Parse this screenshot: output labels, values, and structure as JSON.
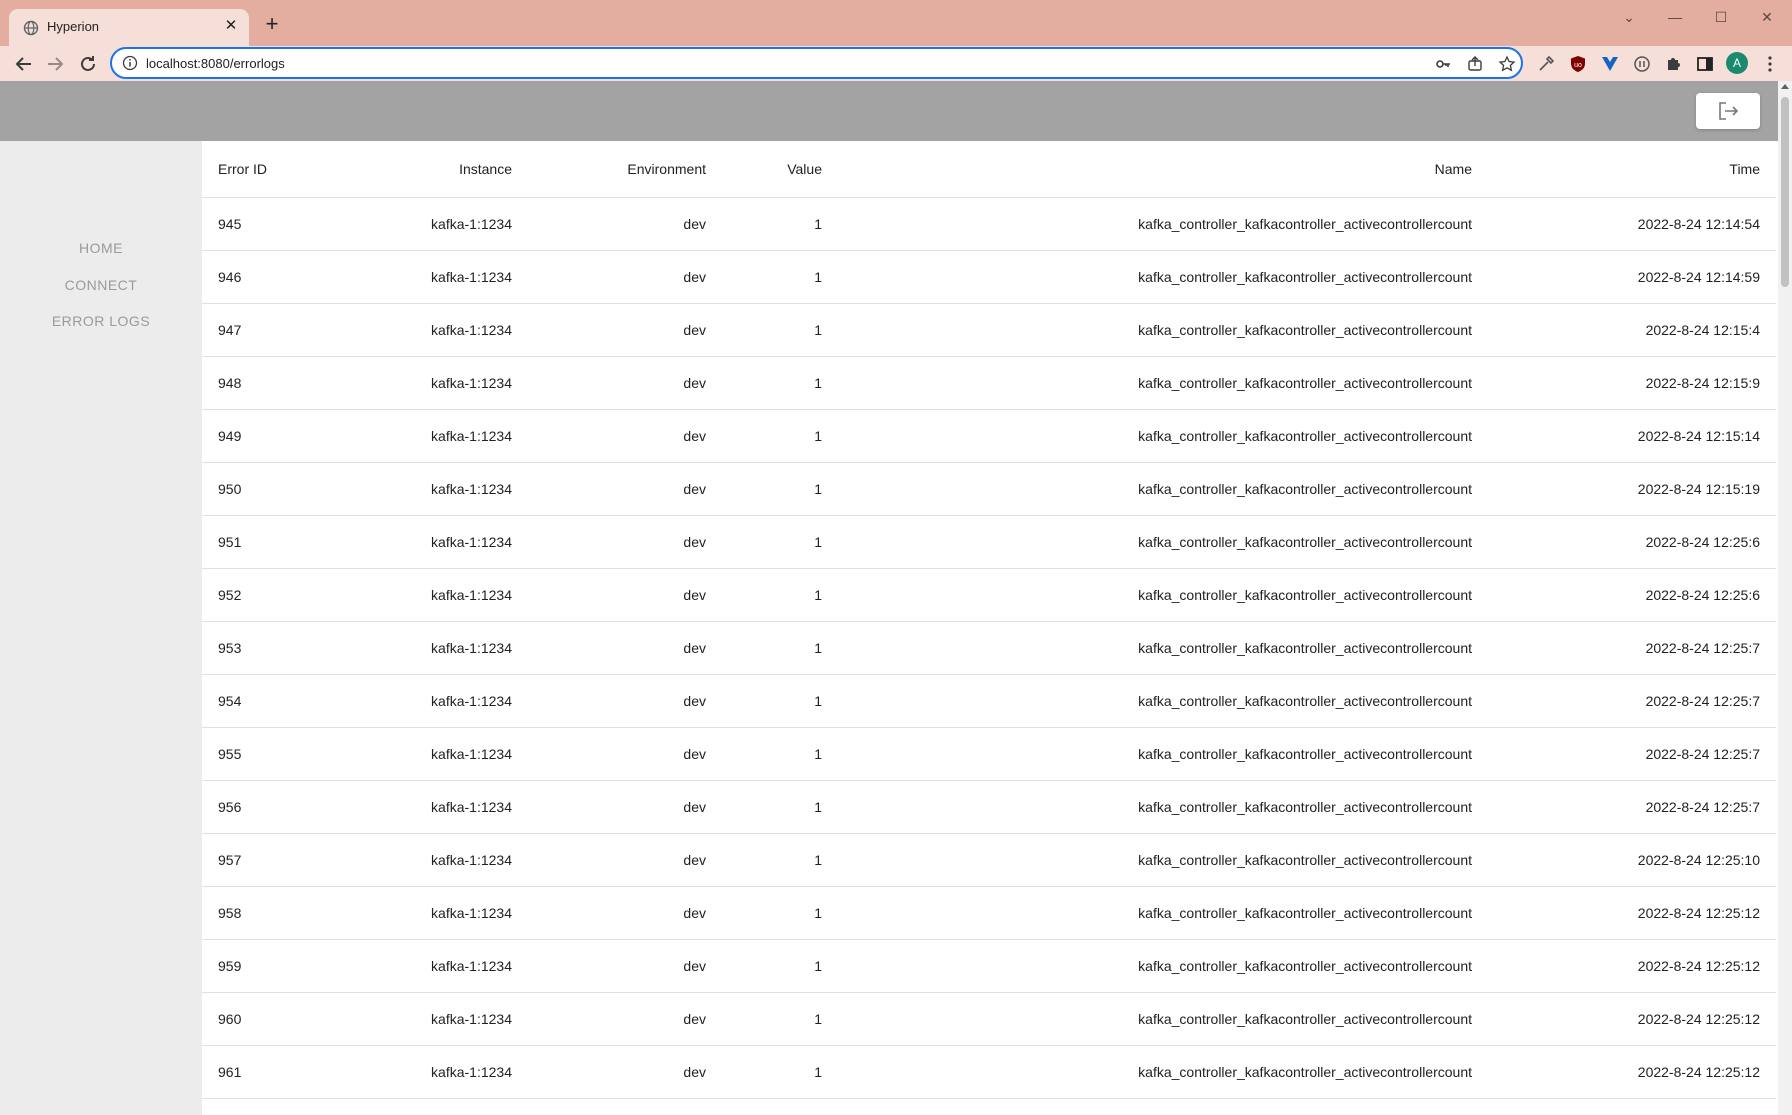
{
  "browser": {
    "tab_title": "Hyperion",
    "tab_close_glyph": "✕",
    "new_tab_glyph": "+",
    "url": "localhost:8080/errorlogs",
    "profile_initial": "A",
    "window_controls": [
      "⌄",
      "—",
      "☐",
      "✕"
    ]
  },
  "sidebar": {
    "items": [
      {
        "label": "HOME"
      },
      {
        "label": "CONNECT"
      },
      {
        "label": "ERROR LOGS"
      }
    ]
  },
  "table": {
    "headers": {
      "error_id": "Error ID",
      "instance": "Instance",
      "environment": "Environment",
      "value": "Value",
      "name": "Name",
      "time": "Time"
    },
    "rows": [
      {
        "id": "945",
        "instance": "kafka-1:1234",
        "environment": "dev",
        "value": "1",
        "name": "kafka_controller_kafkacontroller_activecontrollercount",
        "time": "2022-8-24 12:14:54"
      },
      {
        "id": "946",
        "instance": "kafka-1:1234",
        "environment": "dev",
        "value": "1",
        "name": "kafka_controller_kafkacontroller_activecontrollercount",
        "time": "2022-8-24 12:14:59"
      },
      {
        "id": "947",
        "instance": "kafka-1:1234",
        "environment": "dev",
        "value": "1",
        "name": "kafka_controller_kafkacontroller_activecontrollercount",
        "time": "2022-8-24 12:15:4"
      },
      {
        "id": "948",
        "instance": "kafka-1:1234",
        "environment": "dev",
        "value": "1",
        "name": "kafka_controller_kafkacontroller_activecontrollercount",
        "time": "2022-8-24 12:15:9"
      },
      {
        "id": "949",
        "instance": "kafka-1:1234",
        "environment": "dev",
        "value": "1",
        "name": "kafka_controller_kafkacontroller_activecontrollercount",
        "time": "2022-8-24 12:15:14"
      },
      {
        "id": "950",
        "instance": "kafka-1:1234",
        "environment": "dev",
        "value": "1",
        "name": "kafka_controller_kafkacontroller_activecontrollercount",
        "time": "2022-8-24 12:15:19"
      },
      {
        "id": "951",
        "instance": "kafka-1:1234",
        "environment": "dev",
        "value": "1",
        "name": "kafka_controller_kafkacontroller_activecontrollercount",
        "time": "2022-8-24 12:25:6"
      },
      {
        "id": "952",
        "instance": "kafka-1:1234",
        "environment": "dev",
        "value": "1",
        "name": "kafka_controller_kafkacontroller_activecontrollercount",
        "time": "2022-8-24 12:25:6"
      },
      {
        "id": "953",
        "instance": "kafka-1:1234",
        "environment": "dev",
        "value": "1",
        "name": "kafka_controller_kafkacontroller_activecontrollercount",
        "time": "2022-8-24 12:25:7"
      },
      {
        "id": "954",
        "instance": "kafka-1:1234",
        "environment": "dev",
        "value": "1",
        "name": "kafka_controller_kafkacontroller_activecontrollercount",
        "time": "2022-8-24 12:25:7"
      },
      {
        "id": "955",
        "instance": "kafka-1:1234",
        "environment": "dev",
        "value": "1",
        "name": "kafka_controller_kafkacontroller_activecontrollercount",
        "time": "2022-8-24 12:25:7"
      },
      {
        "id": "956",
        "instance": "kafka-1:1234",
        "environment": "dev",
        "value": "1",
        "name": "kafka_controller_kafkacontroller_activecontrollercount",
        "time": "2022-8-24 12:25:7"
      },
      {
        "id": "957",
        "instance": "kafka-1:1234",
        "environment": "dev",
        "value": "1",
        "name": "kafka_controller_kafkacontroller_activecontrollercount",
        "time": "2022-8-24 12:25:10"
      },
      {
        "id": "958",
        "instance": "kafka-1:1234",
        "environment": "dev",
        "value": "1",
        "name": "kafka_controller_kafkacontroller_activecontrollercount",
        "time": "2022-8-24 12:25:12"
      },
      {
        "id": "959",
        "instance": "kafka-1:1234",
        "environment": "dev",
        "value": "1",
        "name": "kafka_controller_kafkacontroller_activecontrollercount",
        "time": "2022-8-24 12:25:12"
      },
      {
        "id": "960",
        "instance": "kafka-1:1234",
        "environment": "dev",
        "value": "1",
        "name": "kafka_controller_kafkacontroller_activecontrollercount",
        "time": "2022-8-24 12:25:12"
      },
      {
        "id": "961",
        "instance": "kafka-1:1234",
        "environment": "dev",
        "value": "1",
        "name": "kafka_controller_kafkacontroller_activecontrollercount",
        "time": "2022-8-24 12:25:12"
      }
    ]
  },
  "colors": {
    "tabbar": "#e3aea0",
    "toolbar": "#f5dfd8",
    "header": "#a3a3a3",
    "sidebar": "#ececec",
    "nav_text": "#9a9a9a",
    "omnibox_focus": "#1a73e8"
  }
}
